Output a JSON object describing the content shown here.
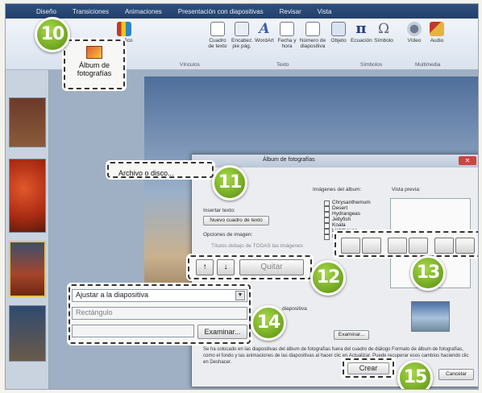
{
  "ribbon": {
    "tabs": [
      "Diseño",
      "Transiciones",
      "Animaciones",
      "Presentación con diapositivas",
      "Revisar",
      "Vista"
    ],
    "items": [
      {
        "label": "Álbum de fotografías"
      },
      {
        "label": "Gráfico"
      },
      {
        "label": "Cuadro de texto"
      },
      {
        "label": "Encabez. pie pág."
      },
      {
        "label": "WordArt"
      },
      {
        "label": "Fecha y hora"
      },
      {
        "label": "Número de diapositiva"
      },
      {
        "label": "Objeto"
      },
      {
        "label": "Ecuación"
      },
      {
        "label": "Símbolo"
      },
      {
        "label": "Vídeo"
      },
      {
        "label": "Audio"
      }
    ],
    "groups": [
      "Vínculos",
      "Texto",
      "Símbolos",
      "Multimedia"
    ]
  },
  "dialog": {
    "title": "Álbum de fotografías",
    "insert_text_label": "Insertar texto:",
    "new_textbox_button": "Nuevo cuadro de texto",
    "picture_options_label": "Opciones de imagen:",
    "captions_option": "Títulos debajo de TODAS las imágenes",
    "album_images_label": "Imágenes del álbum:",
    "album_images": [
      "Chrysanthemum",
      "Desert",
      "Hydrangeas",
      "Jellyfish",
      "Koala",
      "Lighthouse",
      "Penguins"
    ],
    "preview_label": "Vista previa:",
    "layout_label": "diapositiva",
    "footer_text": "Se ha colocado en las diapositivas del álbum de fotografías fuera del cuadro de diálogo Formato de álbum de fotografías, como el fondo y las animaciones de las diapositivas al hacer clic en Actualizar. Puede recuperar esos cambios haciendo clic en Deshacer.",
    "browse_button_small": "Examinar...",
    "cancel_button": "Cancelar"
  },
  "callouts": {
    "album_button": "Álbum de fotografías",
    "file_disk_button": "Archivo o disco...",
    "up_arrow": "↑",
    "down_arrow": "↓",
    "remove_button": "Quitar",
    "layout_select": "Ajustar a la diapositiva",
    "frame_shape": "Rectángulo",
    "browse_button": "Examinar...",
    "create_button": "Crear"
  },
  "steps": [
    "10",
    "11",
    "12",
    "13",
    "14",
    "15"
  ]
}
